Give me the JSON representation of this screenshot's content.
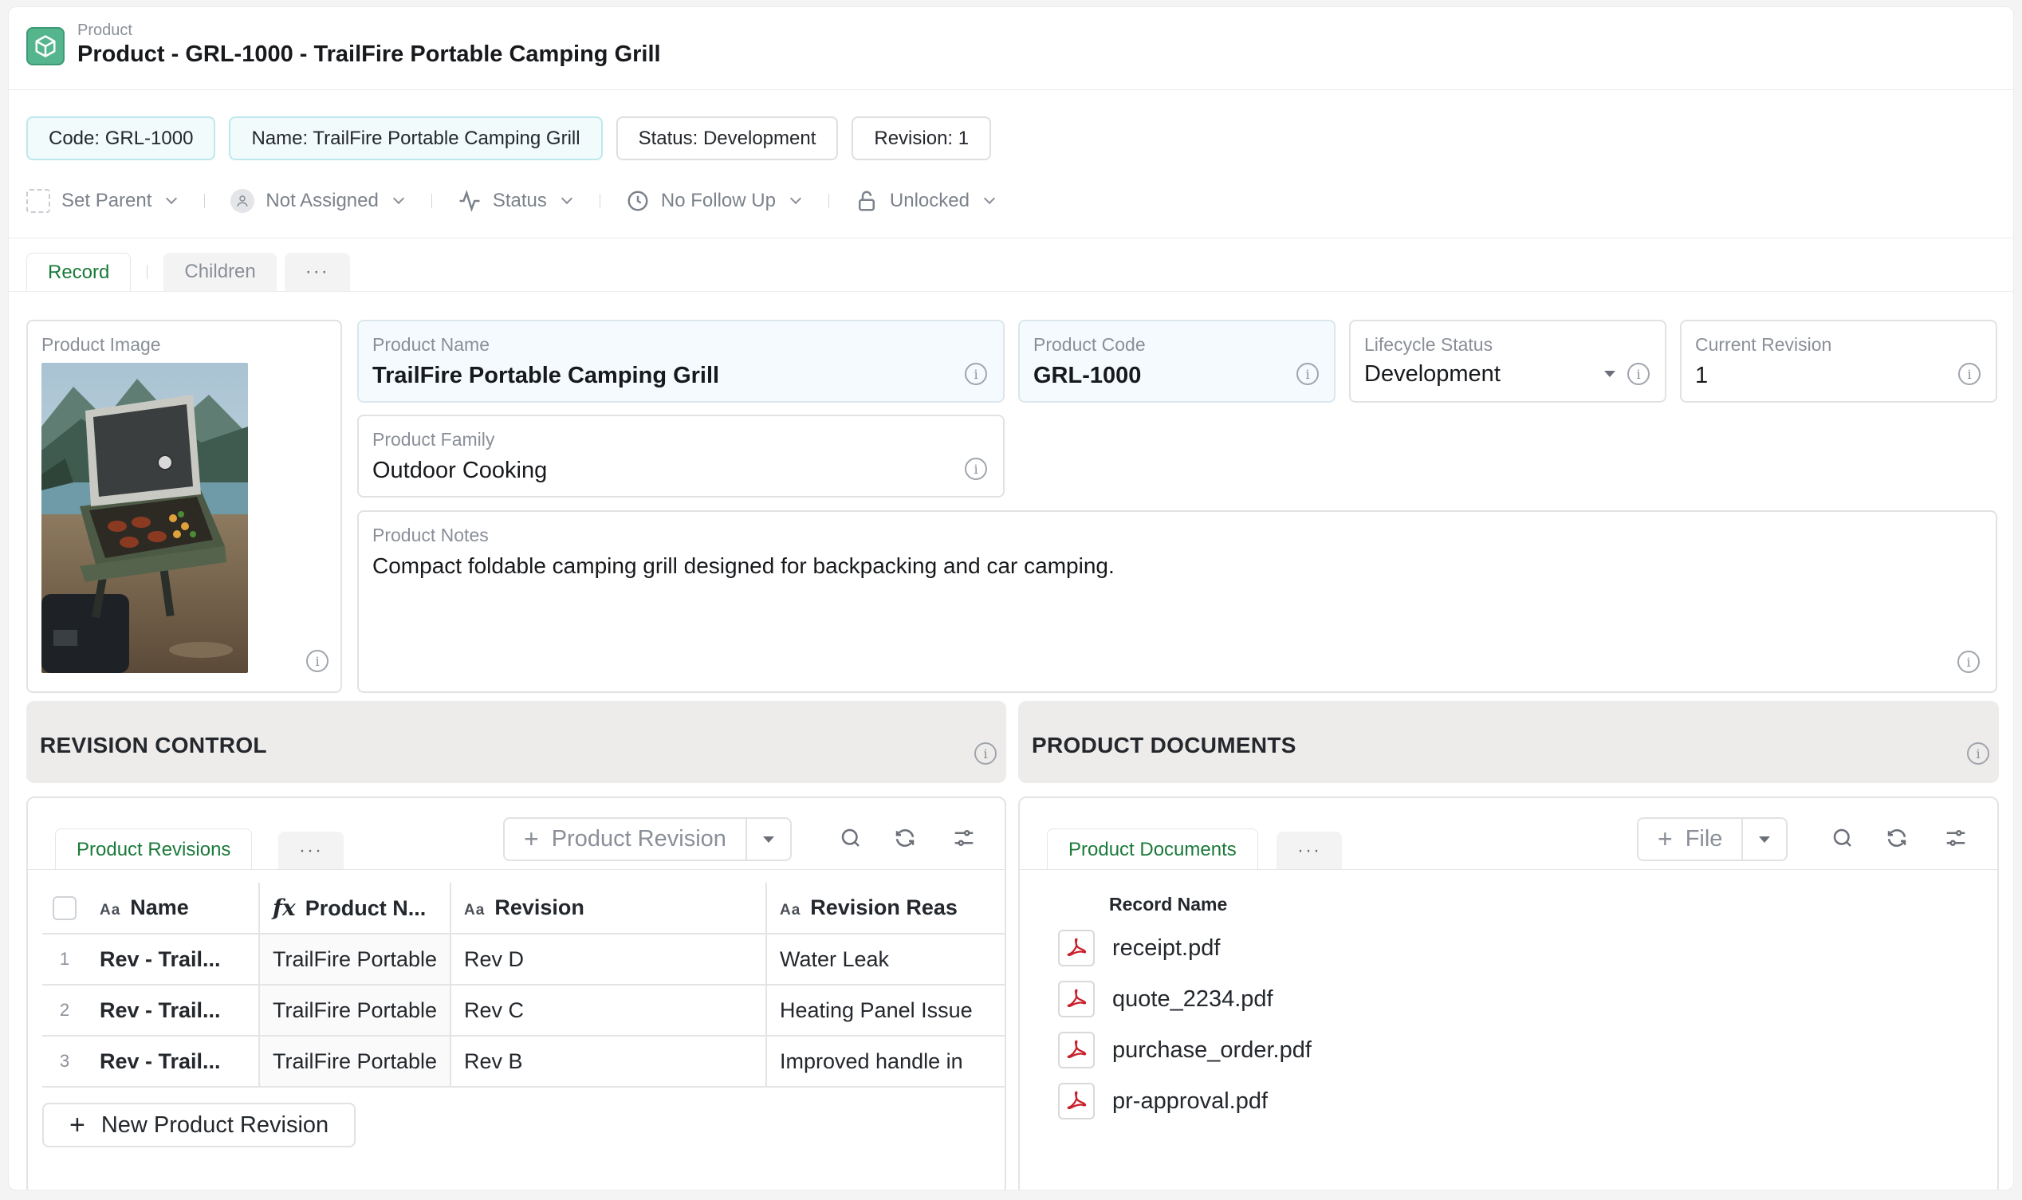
{
  "header": {
    "crumb": "Product",
    "title": "Product - GRL-1000 - TrailFire Portable Camping Grill",
    "icon": "product-cube-icon"
  },
  "chips": {
    "code": "Code: GRL-1000",
    "name": "Name: TrailFire Portable Camping Grill",
    "status": "Status: Development",
    "revision": "Revision: 1"
  },
  "toolbar": {
    "set_parent": "Set Parent",
    "assignee": "Not Assigned",
    "status": "Status",
    "follow_up": "No Follow Up",
    "lock": "Unlocked"
  },
  "tabs": {
    "record": "Record",
    "children": "Children",
    "more": "···"
  },
  "fields": {
    "image_label": "Product Image",
    "name_label": "Product Name",
    "name_value": "TrailFire Portable Camping Grill",
    "code_label": "Product Code",
    "code_value": "GRL-1000",
    "lifecycle_label": "Lifecycle Status",
    "lifecycle_value": "Development",
    "revision_label": "Current Revision",
    "revision_value": "1",
    "family_label": "Product Family",
    "family_value": "Outdoor Cooking",
    "notes_label": "Product Notes",
    "notes_value": "Compact foldable camping grill designed for backpacking and car camping."
  },
  "revision_section": {
    "title": "REVISION CONTROL",
    "tab": "Product Revisions",
    "more": "···",
    "add_button": "Product Revision",
    "columns": [
      "Name",
      "Product N...",
      "Revision",
      "Revision Reas"
    ],
    "column_icons": [
      "Aa",
      "fx",
      "Aa",
      "Aa"
    ],
    "rows": [
      {
        "idx": "1",
        "name": "Rev - Trail...",
        "product": "TrailFire Portable",
        "revision": "Rev D",
        "reason": "Water Leak"
      },
      {
        "idx": "2",
        "name": "Rev - Trail...",
        "product": "TrailFire Portable",
        "revision": "Rev C",
        "reason": "Heating Panel Issue"
      },
      {
        "idx": "3",
        "name": "Rev - Trail...",
        "product": "TrailFire Portable",
        "revision": "Rev B",
        "reason": "Improved handle in"
      }
    ],
    "new_button": "New Product Revision"
  },
  "documents_section": {
    "title": "PRODUCT DOCUMENTS",
    "tab": "Product Documents",
    "more": "···",
    "add_button": "File",
    "column": "Record Name",
    "files": [
      "receipt.pdf",
      "quote_2234.pdf",
      "purchase_order.pdf",
      "pr-approval.pdf"
    ]
  },
  "colors": {
    "accent_green": "#1a7a3a",
    "logo_green": "#55b58d",
    "pdf_red": "#c8202a",
    "banner_bg": "#eeecea"
  }
}
